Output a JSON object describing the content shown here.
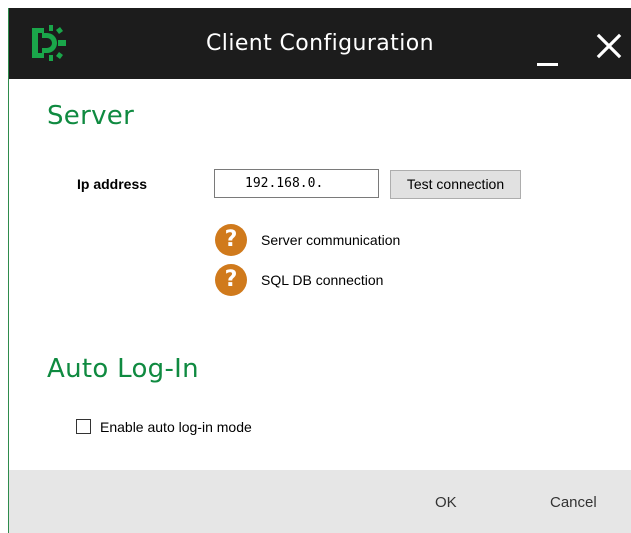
{
  "window": {
    "title": "Client Configuration",
    "accent_color": "#0f8a40",
    "titlebar_color": "#1c1c1c"
  },
  "server": {
    "heading": "Server",
    "ip_label": "Ip address",
    "ip_value": "192.168.0.",
    "test_button": "Test connection",
    "statuses": [
      {
        "icon": "question-icon",
        "text": "Server communication",
        "color": "#d07a1c"
      },
      {
        "icon": "question-icon",
        "text": "SQL DB connection",
        "color": "#d07a1c"
      }
    ]
  },
  "auto_login": {
    "heading": "Auto Log-In",
    "checkbox_label": "Enable auto log-in mode",
    "checked": false
  },
  "footer": {
    "ok_label": "OK",
    "cancel_label": "Cancel"
  }
}
